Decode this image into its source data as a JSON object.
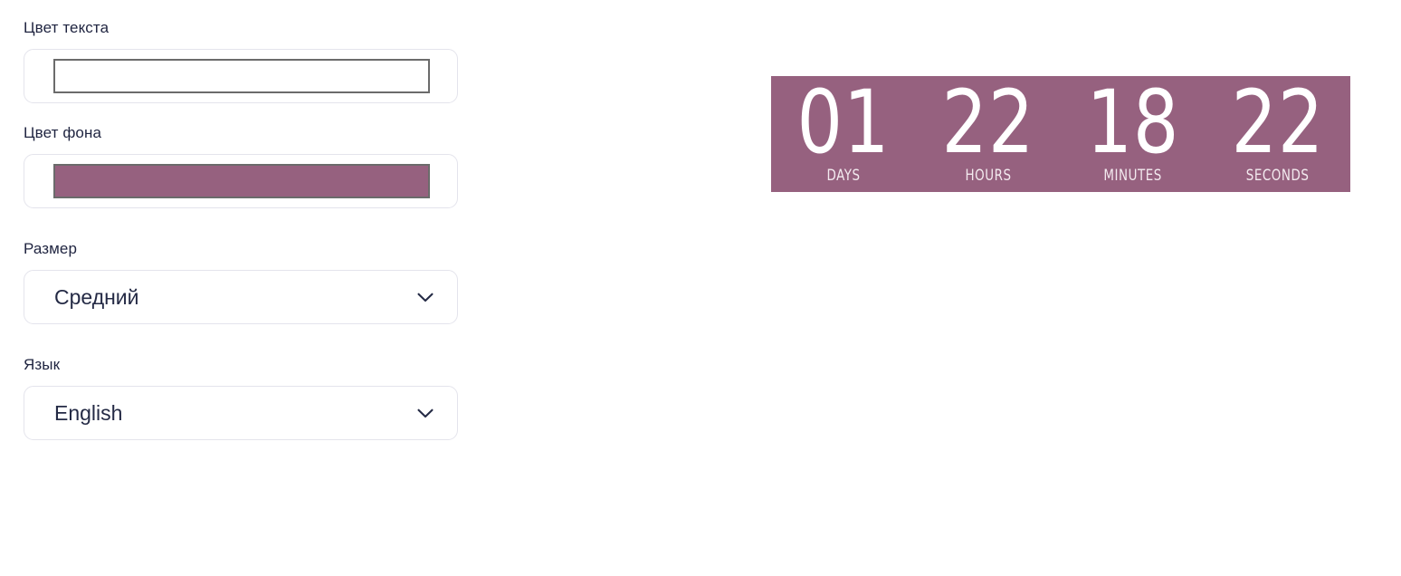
{
  "settings": {
    "fields": [
      {
        "label": "Цвет текста",
        "type": "color",
        "value": "#ffffff",
        "swatch_border": "#6b6b6b"
      },
      {
        "label": "Цвет фона",
        "type": "color",
        "value": "#96617f",
        "swatch_border": "#6b6b6b"
      },
      {
        "label": "Размер",
        "type": "select",
        "value": "Средний",
        "icon": "chevron-down-icon"
      },
      {
        "label": "Язык",
        "type": "select",
        "value": "English",
        "icon": "chevron-down-icon"
      }
    ]
  },
  "preview": {
    "background_color": "#96617f",
    "text_color": "#ffffff",
    "countdown": [
      {
        "value": "01",
        "label": "DAYS"
      },
      {
        "value": "22",
        "label": "HOURS"
      },
      {
        "value": "18",
        "label": "MINUTES"
      },
      {
        "value": "22",
        "label": "SECONDS"
      }
    ]
  }
}
